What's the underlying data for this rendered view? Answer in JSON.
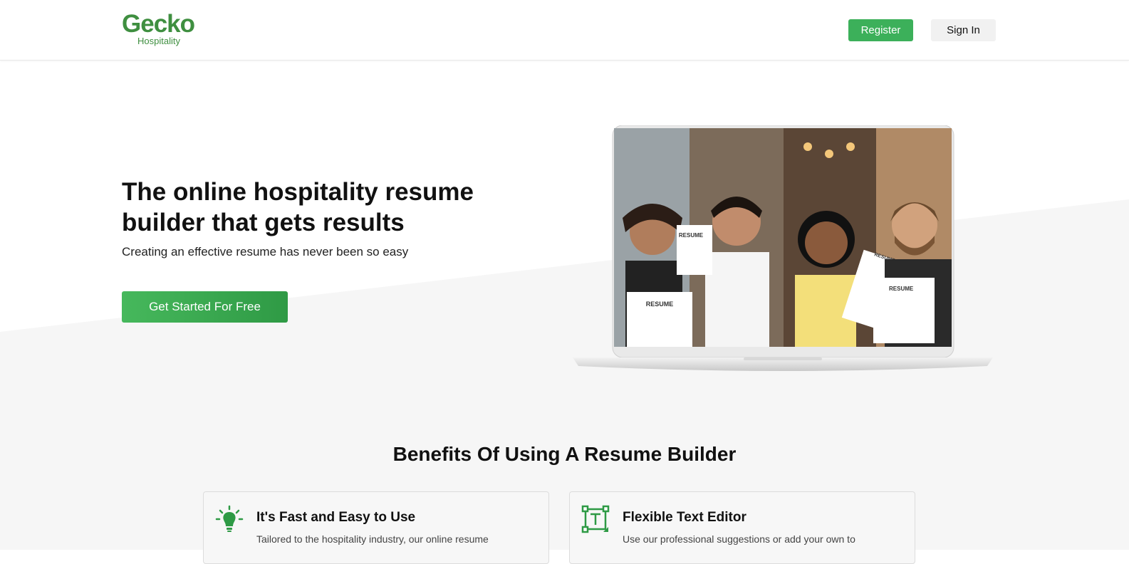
{
  "brand": {
    "name": "Gecko",
    "tagline": "Hospitality",
    "color": "#3f8f40"
  },
  "nav": {
    "register_label": "Register",
    "signin_label": "Sign In"
  },
  "hero": {
    "title": "The online hospitality resume builder that gets results",
    "subtitle": "Creating an effective resume has never been so easy",
    "cta_label": "Get Started For Free",
    "image": {
      "subject": "laptop showing four hospitality workers holding resumes",
      "resume_labels": [
        "RESUME",
        "RESUME",
        "RESUME",
        "RESUME"
      ]
    }
  },
  "benefits": {
    "title": "Benefits Of Using A Resume Builder",
    "items": [
      {
        "icon": "lightbulb-icon",
        "title": "It's Fast and Easy to Use",
        "text": "Tailored to the hospitality industry, our online resume"
      },
      {
        "icon": "text-editor-icon",
        "title": "Flexible Text Editor",
        "text": "Use our professional suggestions or add your own to"
      }
    ]
  },
  "colors": {
    "accent": "#3cb05a",
    "hero_bg": "#f6f6f6"
  }
}
